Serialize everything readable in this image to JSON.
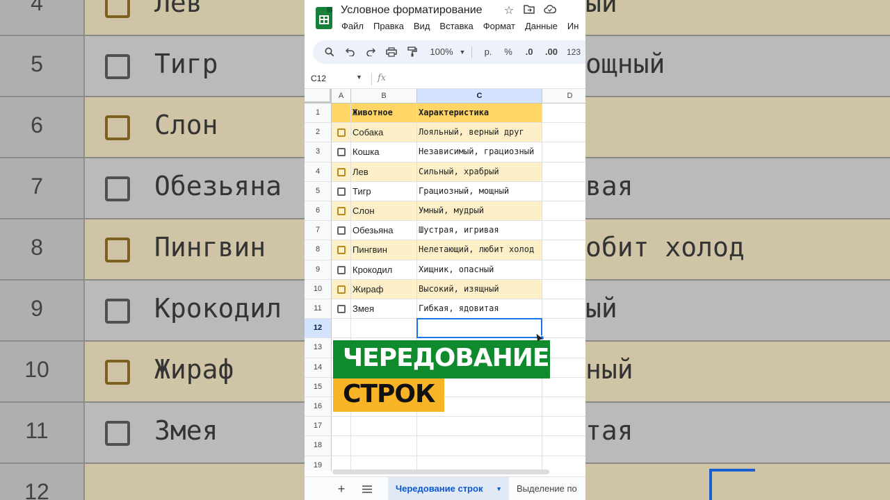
{
  "app": {
    "doc_title": "Условное форматирование",
    "menus": [
      "Файл",
      "Правка",
      "Вид",
      "Вставка",
      "Формат",
      "Данные",
      "Ин"
    ]
  },
  "toolbar": {
    "zoom": "100%",
    "currency": "р.",
    "percent": "%",
    "dec_decrease": ".0",
    "dec_increase": ".00",
    "number_format": "123"
  },
  "formula_bar": {
    "name_box": "C12",
    "fx_label": "fx",
    "value": ""
  },
  "columns": [
    "A",
    "B",
    "C",
    "D"
  ],
  "selected_column": "C",
  "header_row": {
    "animal": "Животное",
    "trait": "Характеристика"
  },
  "rows": [
    {
      "num": "1"
    },
    {
      "num": "2",
      "animal": "Собака",
      "trait": "Лояльный, верный друг"
    },
    {
      "num": "3",
      "animal": "Кошка",
      "trait": "Независимый, грациозный"
    },
    {
      "num": "4",
      "animal": "Лев",
      "trait": "Сильный, храбрый"
    },
    {
      "num": "5",
      "animal": "Тигр",
      "trait": "Грациозный, мощный"
    },
    {
      "num": "6",
      "animal": "Слон",
      "trait": "Умный, мудрый"
    },
    {
      "num": "7",
      "animal": "Обезьяна",
      "trait": "Шустрая, игривая"
    },
    {
      "num": "8",
      "animal": "Пингвин",
      "trait": "Нелетающий, любит холод"
    },
    {
      "num": "9",
      "animal": "Крокодил",
      "trait": "Хищник, опасный"
    },
    {
      "num": "10",
      "animal": "Жираф",
      "trait": "Высокий, изящный"
    },
    {
      "num": "11",
      "animal": "Змея",
      "trait": "Гибкая, ядовитая"
    }
  ],
  "empty_rows": [
    "12",
    "13",
    "14",
    "15",
    "16",
    "17",
    "18",
    "19"
  ],
  "selected_row": "12",
  "overlay": {
    "line1": "ЧЕРЕДОВАНИЕ",
    "line2": "СТРОК"
  },
  "sheet_tabs": {
    "active": "Чередование строк",
    "other": "Выделение по"
  },
  "background": {
    "rows": [
      {
        "num": "4",
        "name": "Лев",
        "right": "ый"
      },
      {
        "num": "5",
        "name": "Тигр",
        "right": "ощный"
      },
      {
        "num": "6",
        "name": "Слон",
        "right": ""
      },
      {
        "num": "7",
        "name": "Обезьяна",
        "right": "вая"
      },
      {
        "num": "8",
        "name": "Пингвин",
        "right": "обит холод"
      },
      {
        "num": "9",
        "name": "Крокодил",
        "right": "ый"
      },
      {
        "num": "10",
        "name": "Жираф",
        "right": "ный"
      },
      {
        "num": "11",
        "name": "Змея",
        "right": "тая"
      },
      {
        "num": "12",
        "name": "",
        "right": ""
      }
    ]
  },
  "colors": {
    "header_fill": "#ffd666",
    "band_fill": "#fdefc8",
    "selection": "#1a73e8",
    "banner_green": "#0f8a2c",
    "banner_yellow": "#f6b426"
  }
}
